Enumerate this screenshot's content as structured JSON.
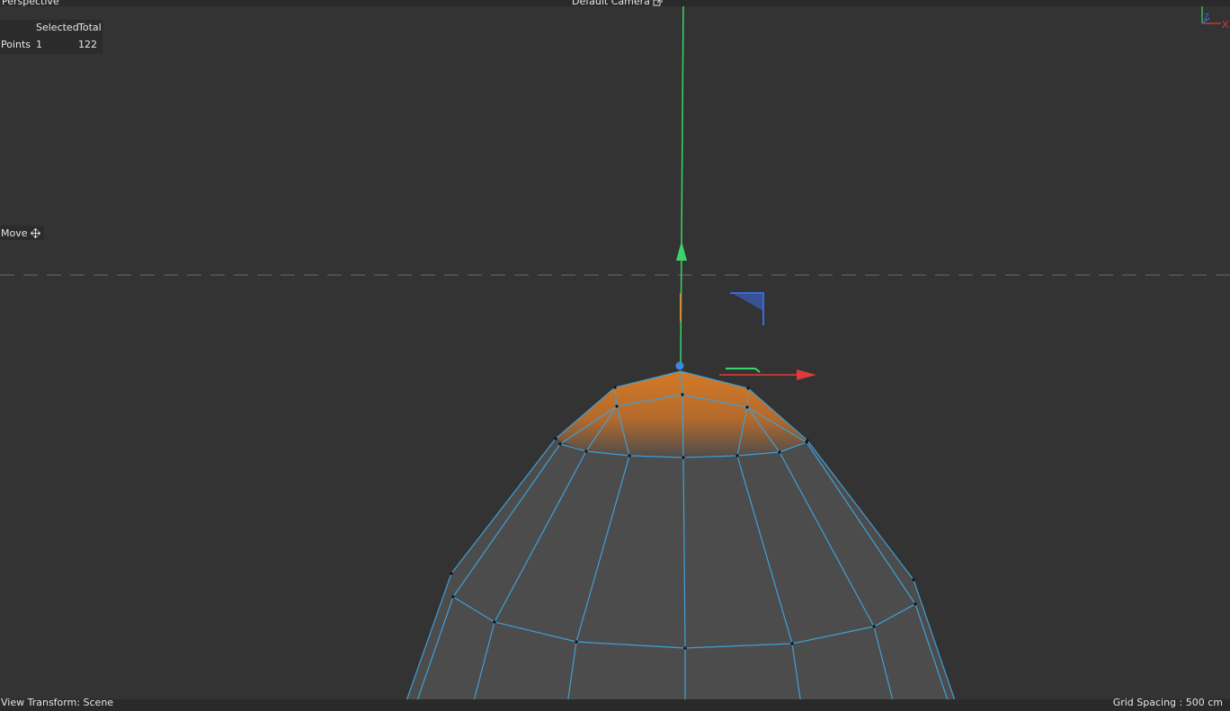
{
  "viewport": {
    "view_name": "Perspective",
    "camera_label": "Default Camera",
    "camera_icon": "camera-link-icon",
    "axis_labels": {
      "z": "Z",
      "x": "X"
    }
  },
  "hud": {
    "header_selected": "Selected",
    "header_total": "Total",
    "row_label": "Points",
    "row_selected": "1",
    "row_total": "122"
  },
  "tool": {
    "label": "Move",
    "icon": "move-arrows-icon"
  },
  "status": {
    "view_transform": "View Transform: Scene",
    "grid_spacing": "Grid Spacing : 500 cm"
  },
  "colors": {
    "background": "#333333",
    "wireframe": "#3fa0d8",
    "mesh_fill": "#4c4c4c",
    "selection": "#d47a28",
    "axis_x": "#e23a3a",
    "axis_y": "#3ad46a",
    "axis_z": "#3a6ae0"
  }
}
